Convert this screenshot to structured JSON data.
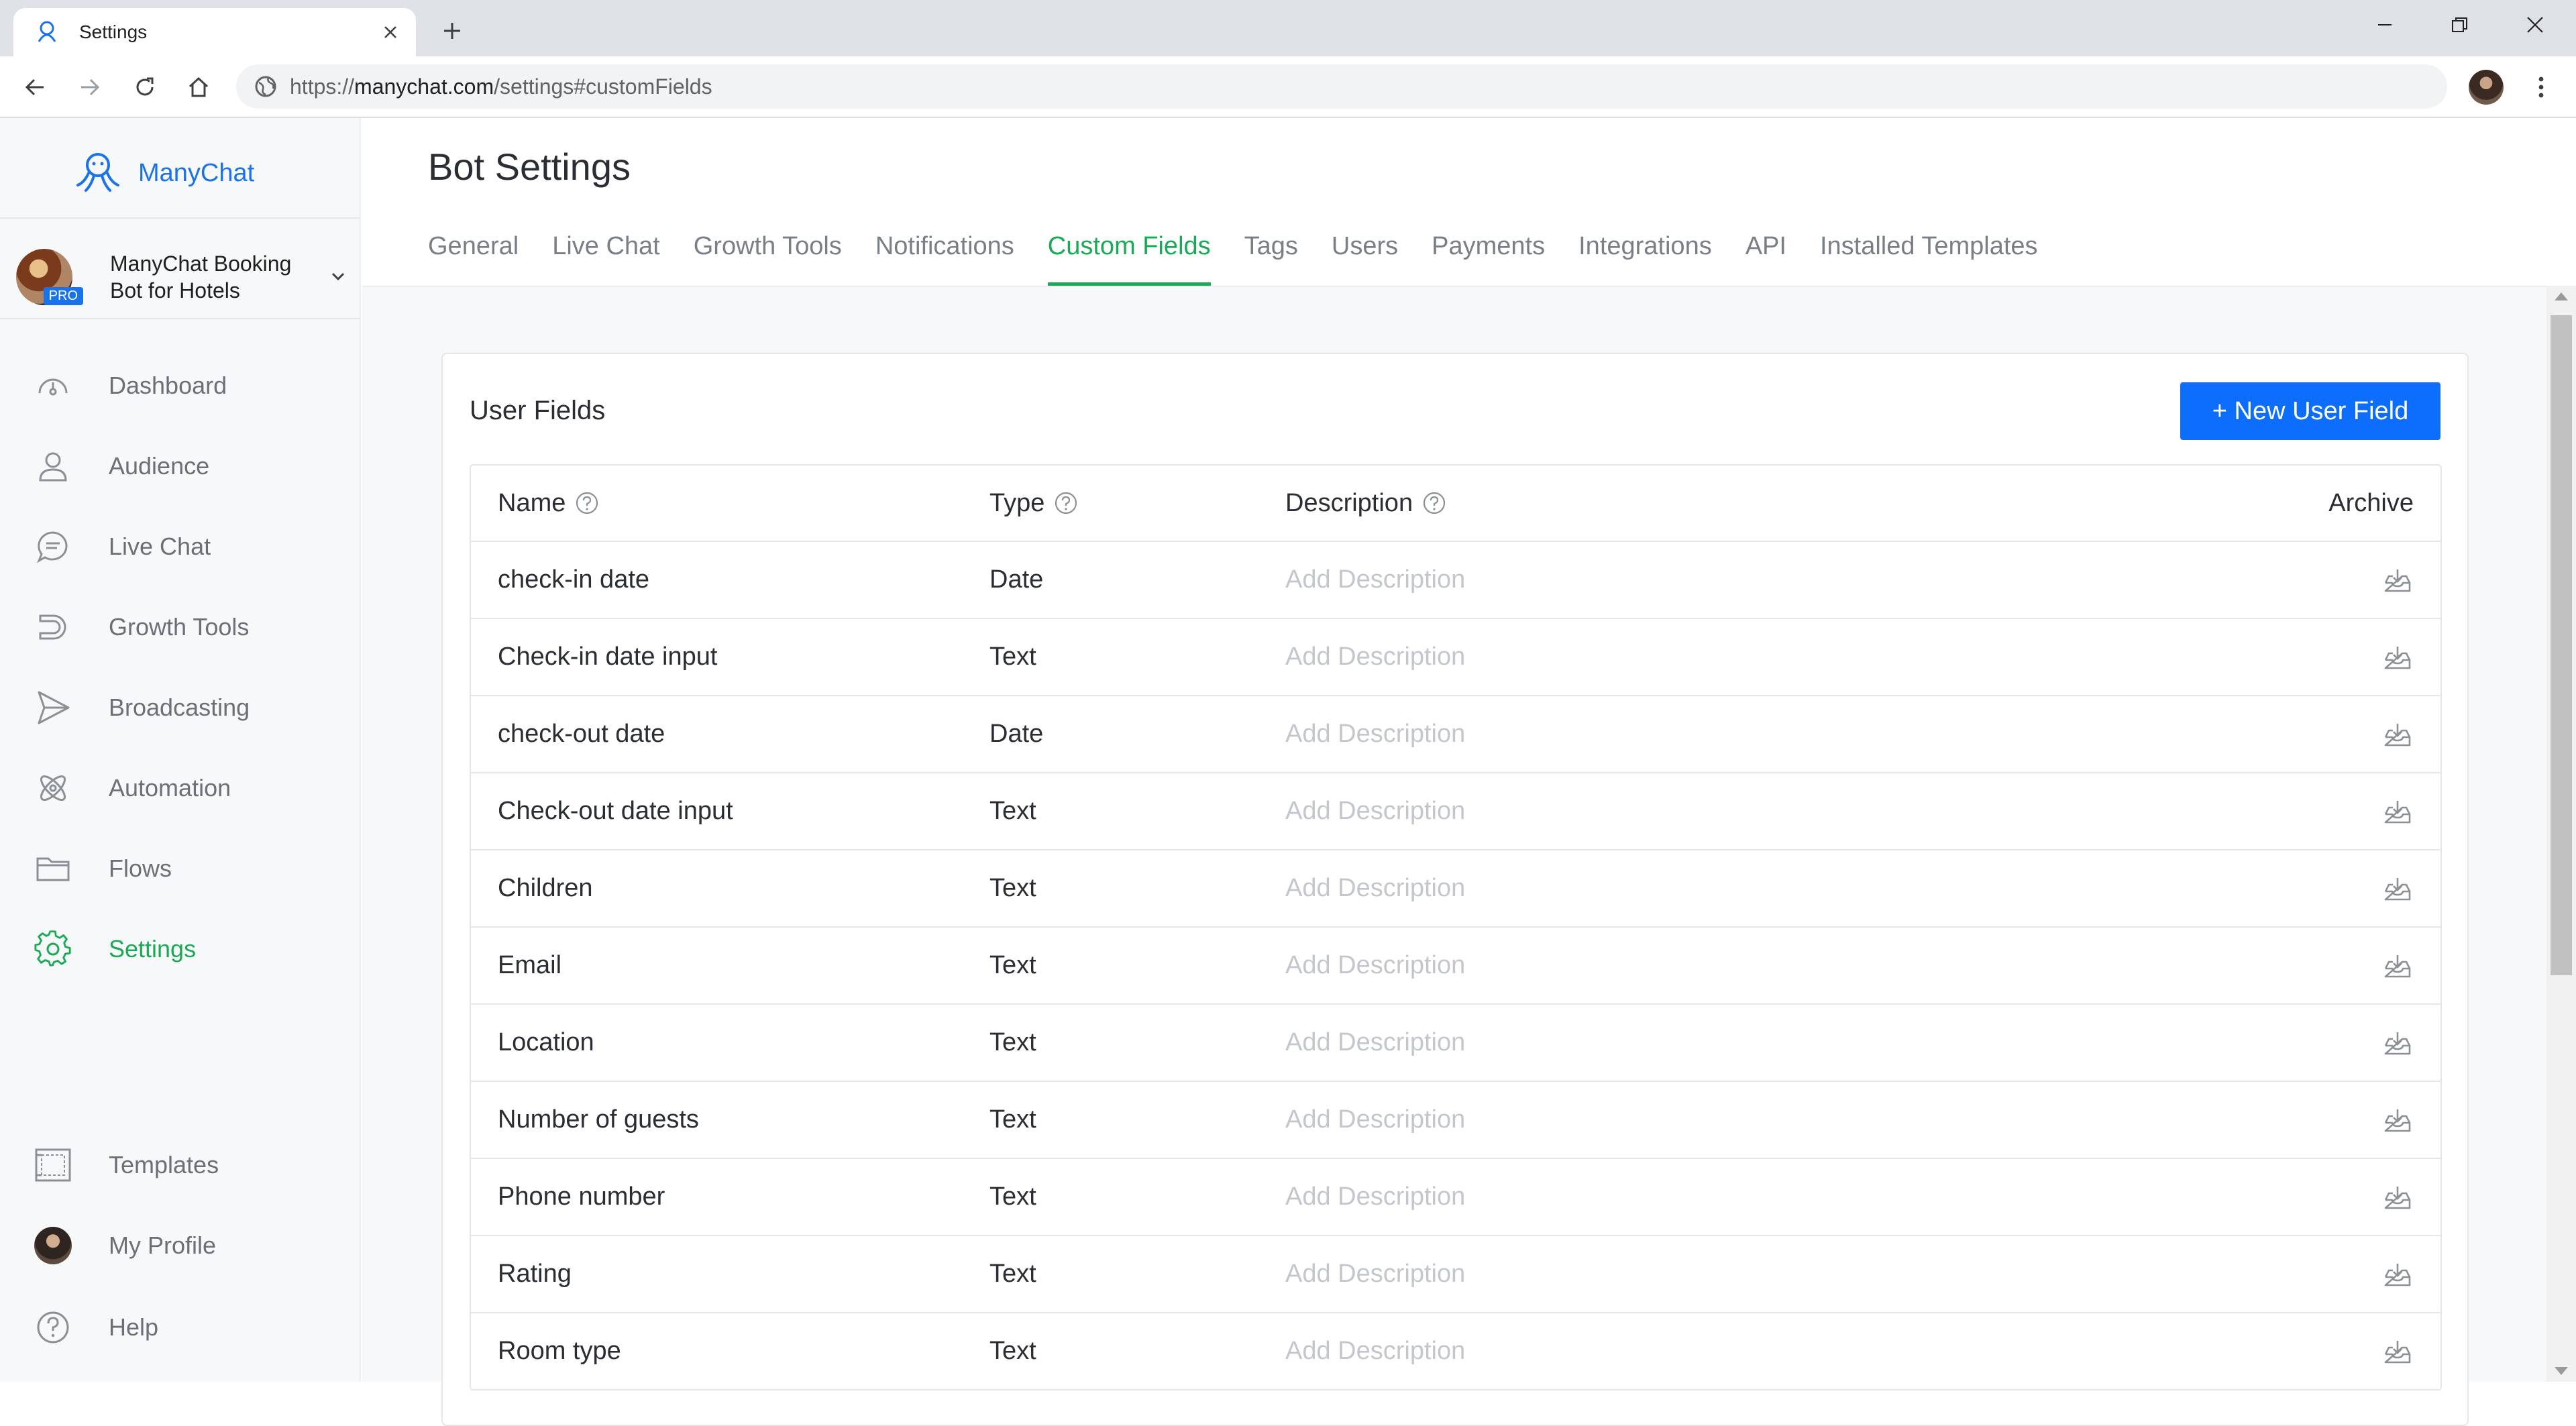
{
  "browser": {
    "tab_title": "Settings",
    "url_prefix": "https://",
    "url_domain": "manychat.com",
    "url_path": "/settings#customFields"
  },
  "sidebar": {
    "brand": "ManyChat",
    "account": {
      "name": "ManyChat Booking Bot for Hotels",
      "badge": "PRO"
    },
    "items": [
      {
        "label": "Dashboard",
        "icon": "dashboard-icon"
      },
      {
        "label": "Audience",
        "icon": "person-icon"
      },
      {
        "label": "Live Chat",
        "icon": "chat-bubble-icon"
      },
      {
        "label": "Growth Tools",
        "icon": "magnet-icon"
      },
      {
        "label": "Broadcasting",
        "icon": "send-icon"
      },
      {
        "label": "Automation",
        "icon": "atom-icon"
      },
      {
        "label": "Flows",
        "icon": "folder-icon"
      },
      {
        "label": "Settings",
        "icon": "gear-icon",
        "active": true
      }
    ],
    "bottom_items": [
      {
        "label": "Templates",
        "icon": "template-icon"
      },
      {
        "label": "My Profile",
        "icon": "avatar"
      },
      {
        "label": "Help",
        "icon": "question-icon"
      }
    ]
  },
  "main": {
    "title": "Bot Settings",
    "tabs": [
      {
        "label": "General"
      },
      {
        "label": "Live Chat"
      },
      {
        "label": "Growth Tools"
      },
      {
        "label": "Notifications"
      },
      {
        "label": "Custom Fields",
        "active": true
      },
      {
        "label": "Tags"
      },
      {
        "label": "Users"
      },
      {
        "label": "Payments"
      },
      {
        "label": "Integrations"
      },
      {
        "label": "API"
      },
      {
        "label": "Installed Templates"
      }
    ],
    "card": {
      "title": "User Fields",
      "new_button": "+ New User Field",
      "columns": {
        "name": "Name",
        "type": "Type",
        "description": "Description",
        "archive": "Archive"
      },
      "rows": [
        {
          "name": "check-in date",
          "type": "Date",
          "description": "Add Description"
        },
        {
          "name": "Check-in date input",
          "type": "Text",
          "description": "Add Description"
        },
        {
          "name": "check-out date",
          "type": "Date",
          "description": "Add Description"
        },
        {
          "name": "Check-out date input",
          "type": "Text",
          "description": "Add Description"
        },
        {
          "name": "Children",
          "type": "Text",
          "description": "Add Description"
        },
        {
          "name": "Email",
          "type": "Text",
          "description": "Add Description"
        },
        {
          "name": "Location",
          "type": "Text",
          "description": "Add Description"
        },
        {
          "name": "Number of guests",
          "type": "Text",
          "description": "Add Description"
        },
        {
          "name": "Phone number",
          "type": "Text",
          "description": "Add Description"
        },
        {
          "name": "Rating",
          "type": "Text",
          "description": "Add Description"
        },
        {
          "name": "Room type",
          "type": "Text",
          "description": "Add Description"
        }
      ]
    }
  },
  "colors": {
    "accent_green": "#1aaa55",
    "primary_blue": "#0d6efd",
    "brand_blue": "#1a73e8"
  }
}
